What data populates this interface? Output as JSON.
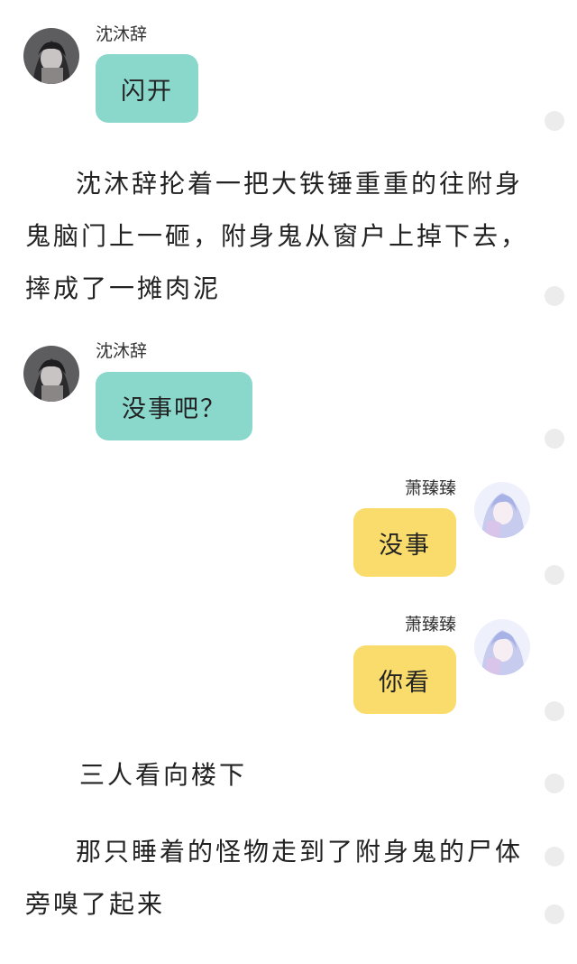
{
  "messages": [
    {
      "speaker": "沈沐辞",
      "text": "闪开",
      "side": "left",
      "color": "#8ad7cc"
    },
    {
      "speaker": "沈沐辞",
      "text": "没事吧？",
      "side": "left",
      "color": "#8ad7cc"
    },
    {
      "speaker": "萧臻臻",
      "text": "没事",
      "side": "right",
      "color": "#f9dc6b"
    },
    {
      "speaker": "萧臻臻",
      "text": "你看",
      "side": "right",
      "color": "#f9dc6b"
    }
  ],
  "narrations": [
    {
      "text": "沈沐辞抡着一把大铁锤重重的往附身鬼脑门上一砸，附身鬼从窗户上掉下去，摔成了一摊肉泥"
    },
    {
      "text": "三人看向楼下"
    },
    {
      "text": "那只睡着的怪物走到了附身鬼的尸体旁嗅了起来"
    }
  ],
  "avatars": {
    "left_speaker_icon": "dark-haired-character-avatar-icon",
    "right_speaker_icon": "pale-haired-character-avatar-icon"
  },
  "side_markers": {
    "icon": "round-comment-dot-icon",
    "count": 8
  }
}
